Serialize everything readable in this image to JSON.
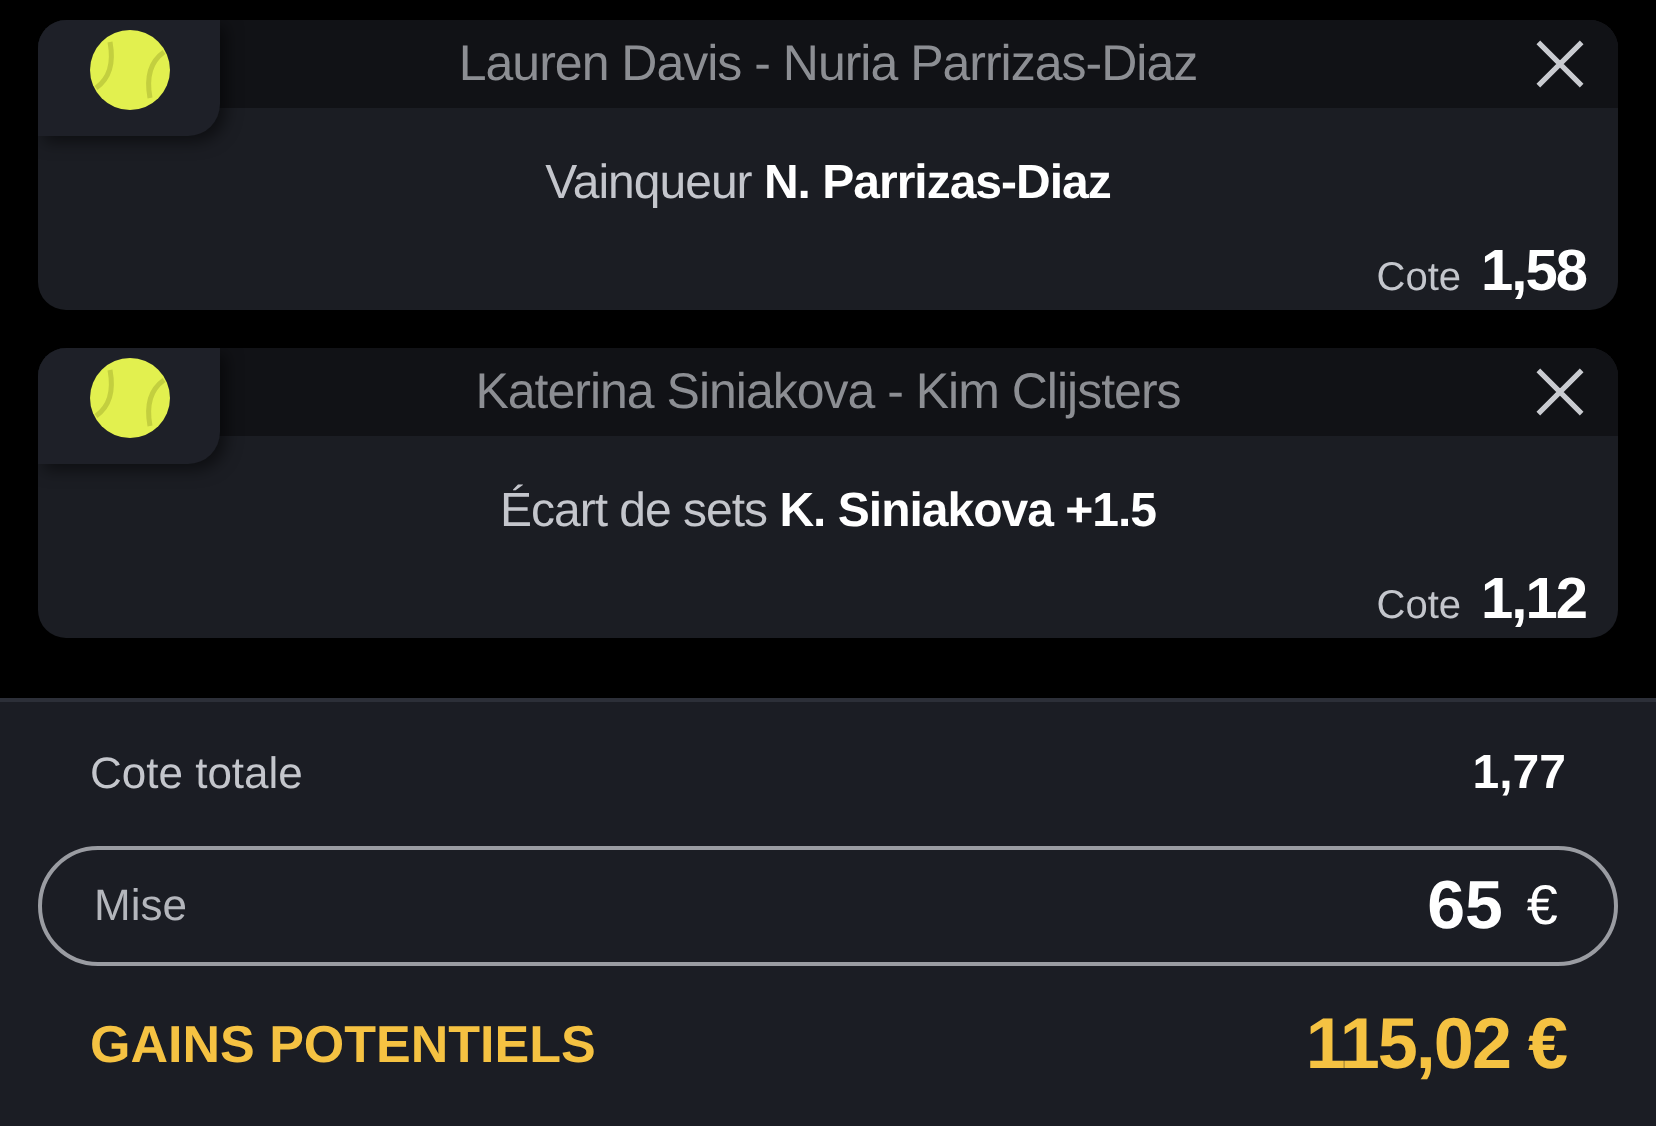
{
  "bets": [
    {
      "match": "Lauren Davis - Nuria Parrizas-Diaz",
      "selection": "Vainqueur **N. Parrizas-Diaz**",
      "odds_label": "Cote",
      "odds": "1,58"
    },
    {
      "match": "Katerina Siniakova - Kim Clijsters",
      "selection": "Écart de sets **K. Siniakova +1.5**",
      "odds_label": "Cote",
      "odds": "1,12"
    }
  ],
  "summary": {
    "total_label": "Cote totale",
    "total": "1,77",
    "stake_label": "Mise",
    "stake": "65",
    "currency": "€",
    "gains_label": "GAINS POTENTIELS",
    "gains": "115,02 €"
  }
}
